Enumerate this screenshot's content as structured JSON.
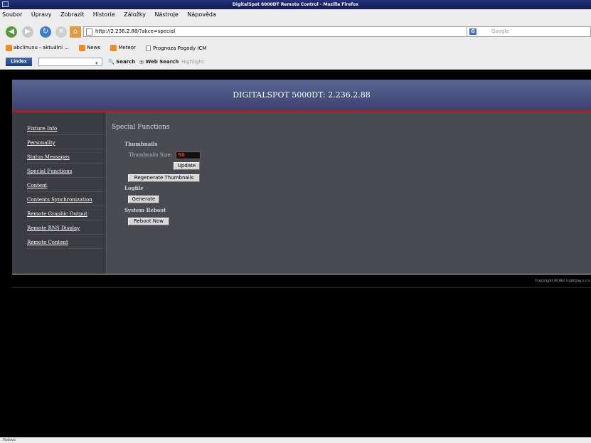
{
  "window": {
    "title": "DigitalSpot 6000DT Remote Control - Mozilla Firefox"
  },
  "menubar": {
    "items": [
      "Soubor",
      "Úpravy",
      "Zobrazit",
      "Historie",
      "Záložky",
      "Nástroje",
      "Nápověda"
    ]
  },
  "navbar": {
    "url": "http://2.236.2.88/?akce=special",
    "search_placeholder": "Google"
  },
  "bookmarks": [
    {
      "label": "abclinuxu - aktuální ...",
      "icon": "rss-icon"
    },
    {
      "label": "News",
      "icon": "rss-icon"
    },
    {
      "label": "Meteor",
      "icon": "rss-icon"
    },
    {
      "label": "Prognoza Pogody ICM",
      "icon": "page-icon"
    }
  ],
  "toolbar2": {
    "logo": "Lindex",
    "search_label": "Search",
    "web_search_label": "Web Search",
    "highlight_label": "Highlight"
  },
  "page": {
    "header_title": "DIGITALSPOT 5000DT: 2.236.2.88",
    "sidebar": [
      "Fixture Info",
      "Personality",
      "Status Messages",
      "Special Functions",
      "Content",
      "Contents Synchronization",
      "Remote Graphic Output",
      "Remote RNS Display",
      "Remote Content"
    ],
    "section_title": "Special Functions",
    "thumbnails_heading": "Thumbnails",
    "thumbnails_size_label": "Thumbnails Size:",
    "thumbnails_size_value": "96",
    "update_button": "Update",
    "regenerate_button": "Regenerate Thumbnails",
    "logfile_heading": "Logfile",
    "generate_button": "Generate",
    "reboot_heading": "System Reboot",
    "reboot_button": "Reboot Now",
    "footer": "Copyright ROBE Lighting s.r.o."
  },
  "status": {
    "text": "Hotovo"
  },
  "colors": {
    "accent_red": "#b71b1b",
    "header_bg": "#4d5787",
    "content_bg": "#4a4a53"
  }
}
